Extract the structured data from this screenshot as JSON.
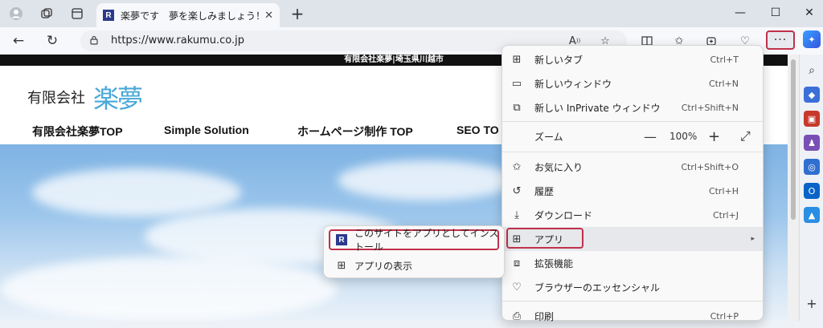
{
  "tab": {
    "favicon": "R",
    "title": "楽夢です　夢を楽しみましょう！",
    "close": "✕"
  },
  "address": {
    "url": "https://www.rakumu.co.jp"
  },
  "page": {
    "header_bar": "有限会社楽夢|埼玉県川越市",
    "logo_small": "有限会社",
    "logo_big": "楽夢",
    "nav": [
      "有限会社楽夢TOP",
      "Simple Solution",
      "ホームページ制作 TOP",
      "SEO TO"
    ]
  },
  "menu": {
    "items": [
      {
        "label": "新しいタブ",
        "shortcut": "Ctrl+T",
        "icon": "new-tab-icon"
      },
      {
        "label": "新しいウィンドウ",
        "shortcut": "Ctrl+N",
        "icon": "new-window-icon"
      },
      {
        "label": "新しい InPrivate ウィンドウ",
        "shortcut": "Ctrl+Shift+N",
        "icon": "inprivate-icon"
      },
      {
        "label": "お気に入り",
        "shortcut": "Ctrl+Shift+O",
        "icon": "favorites-icon"
      },
      {
        "label": "履歴",
        "shortcut": "Ctrl+H",
        "icon": "history-icon"
      },
      {
        "label": "ダウンロード",
        "shortcut": "Ctrl+J",
        "icon": "download-icon"
      },
      {
        "label": "アプリ",
        "shortcut": "▸",
        "icon": "apps-icon"
      },
      {
        "label": "拡張機能",
        "shortcut": "",
        "icon": "extensions-icon"
      },
      {
        "label": "ブラウザーのエッセンシャル",
        "shortcut": "",
        "icon": "heart-pulse-icon"
      },
      {
        "label": "印刷",
        "shortcut": "Ctrl+P",
        "icon": "print-icon"
      }
    ],
    "zoom": {
      "label": "ズーム",
      "minus": "—",
      "value": "100%",
      "plus": "+",
      "fullscreen": "⤢"
    }
  },
  "submenu": {
    "install": "このサイトをアプリとしてインストール",
    "install_icon": "R",
    "view": "アプリの表示"
  },
  "colors": {
    "highlight": "#c0304a",
    "brand": "#2b3a8c"
  }
}
